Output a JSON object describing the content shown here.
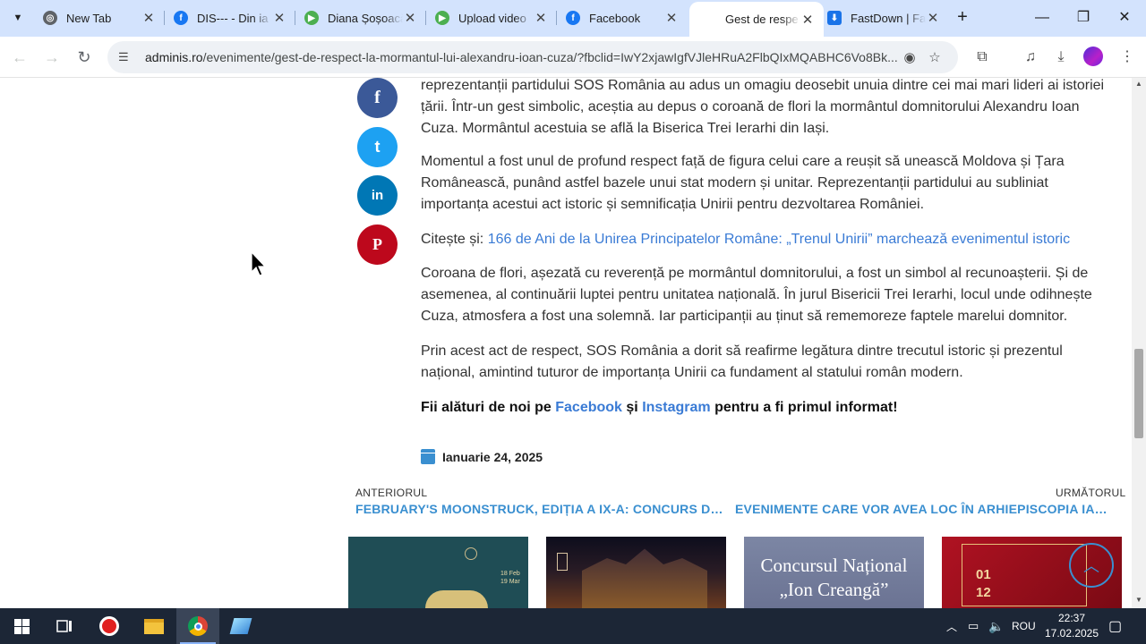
{
  "browser": {
    "tabs": [
      {
        "title": "New Tab",
        "icon": "chrome-icon",
        "color": "#5f6368",
        "active": false
      },
      {
        "title": "DIS--- - Din ia",
        "icon": "facebook-icon",
        "color": "#1877f2",
        "active": false
      },
      {
        "title": "Diana Șoșoacă",
        "icon": "rumble-icon",
        "color": "#4caf50",
        "active": false
      },
      {
        "title": "Upload video",
        "icon": "rumble-icon",
        "color": "#4caf50",
        "active": false
      },
      {
        "title": "Facebook",
        "icon": "facebook-icon",
        "color": "#1877f2",
        "active": false
      },
      {
        "title": "Gest de respe",
        "icon": "blank-icon",
        "color": "#ffffff",
        "active": true
      },
      {
        "title": "FastDown | Fa",
        "icon": "download-icon",
        "color": "#1a73e8",
        "active": false
      }
    ],
    "url_host": "adminis.ro",
    "url_path": "/evenimente/gest-de-respect-la-mormantul-lui-alexandru-ioan-cuza/?fbclid=IwY2xjawIgfVJleHRuA2FlbQIxMQABHC6Vo8Bk..."
  },
  "article": {
    "p1": "reprezentanții partidului SOS România au adus un omagiu deosebit unuia dintre cei mai mari lideri ai istoriei țării. Într-un gest simbolic, aceștia au depus o coroană de flori la mormântul domnitorului Alexandru Ioan Cuza. Mormântul acestuia se află la Biserica Trei Ierarhi din Iași.",
    "p2": "Momentul a fost unul de profund respect față de figura celui care a reușit să unească Moldova și Țara Românească, punând astfel bazele unui stat modern și unitar. Reprezentanții partidului au subliniat importanța acestui act istoric și semnificația Unirii pentru dezvoltarea României.",
    "read_also_label": "Citește și:",
    "read_also_link": "166 de Ani de la Unirea Principatelor Române: „Trenul Unirii” marchează evenimentul istoric",
    "p3": "Coroana de flori, așezată cu reverență pe mormântul domnitorului, a fost un simbol al recunoașterii. Și de asemenea, al continuării luptei pentru unitatea națională. În jurul Bisericii Trei Ierarhi, locul unde odihnește Cuza, atmosfera a fost una solemnă. Iar participanții au ținut să rememoreze faptele marelui domnitor.",
    "p4": "Prin acest act de respect, SOS România a dorit să reafirme legătura dintre trecutul istoric și prezentul național, amintind tuturor de importanța Unirii ca fundament al statului român modern.",
    "follow_pre": "Fii alături de noi pe",
    "follow_fb": "Facebook",
    "follow_and": "și",
    "follow_ig": "Instagram",
    "follow_post": "pentru a fi primul informat!",
    "date": "Ianuarie 24, 2025"
  },
  "share": [
    {
      "name": "facebook",
      "glyph": "f",
      "color": "#3b5998"
    },
    {
      "name": "twitter",
      "glyph": "t",
      "color": "#1da1f2"
    },
    {
      "name": "linkedin",
      "glyph": "in",
      "color": "#0077b5"
    },
    {
      "name": "pinterest",
      "glyph": "P",
      "color": "#bd081c"
    }
  ],
  "post_nav": {
    "prev_label": "ANTERIORUL",
    "prev_title": "FEBRUARY'S MOONSTRUCK, EDIȚIA A IX-A: CONCURS DE SCULPTURĂ",
    "next_label": "URMĂTORUL",
    "next_title": "EVENIMENTE CARE VOR AVEA LOC ÎN ARHIEPISCOPIA IAȘILOR"
  },
  "thumbs": {
    "t3_line1": "Concursul Național",
    "t3_line2": "„Ion Creangă”",
    "t4_num1": "01",
    "t4_num2": "12",
    "t1_date1": "18 Feb",
    "t1_date2": "19 Mar"
  },
  "taskbar": {
    "lang": "ROU",
    "time": "22:37",
    "date": "17.02.2025"
  }
}
